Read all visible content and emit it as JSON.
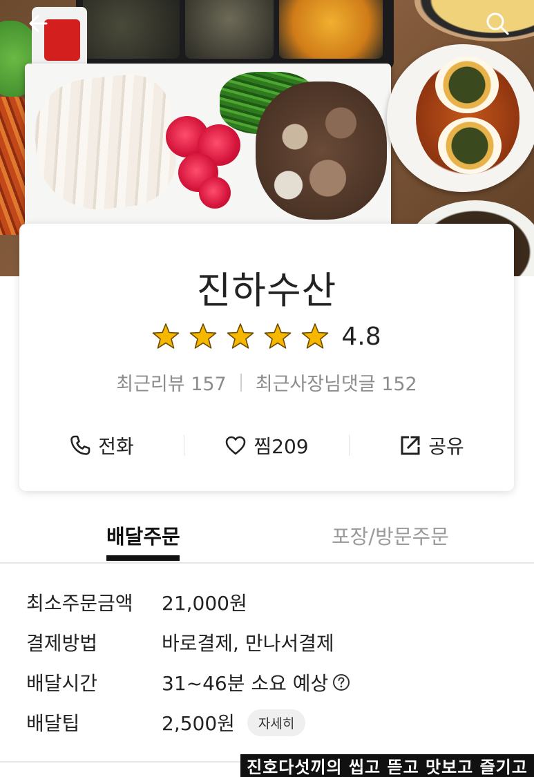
{
  "store": {
    "name": "진하수산",
    "rating": "4.8",
    "stars_filled": 5,
    "recent_reviews": "최근리뷰 157",
    "owner_replies": "최근사장님댓글 152"
  },
  "actions": {
    "call_label": "전화",
    "like_label": "찜209",
    "share_label": "공유"
  },
  "tabs": [
    {
      "label": "배달주문",
      "active": true
    },
    {
      "label": "포장/방문주문",
      "active": false
    }
  ],
  "info": {
    "min_order": {
      "label": "최소주문금액",
      "value": "21,000원"
    },
    "payment": {
      "label": "결제방법",
      "value": "바로결제, 만나서결제"
    },
    "delivery_time": {
      "label": "배달시간",
      "value": "31~46분 소요 예상"
    },
    "delivery_tip": {
      "label": "배달팁",
      "value": "2,500원",
      "detail_label": "자세히"
    }
  },
  "watermark": "진호다섯끼의 씹고 뜯고 맛보고 즐기고",
  "icons": {
    "back": "back-arrow-icon",
    "search": "search-icon",
    "star": "star-icon",
    "call": "phone-icon",
    "like": "heart-icon",
    "share": "share-icon",
    "help": "question-circle-icon"
  },
  "colors": {
    "star": "#f5b700",
    "text_primary": "#222222",
    "text_muted": "#8c8c8c",
    "tab_inactive": "#9a9a9a"
  }
}
